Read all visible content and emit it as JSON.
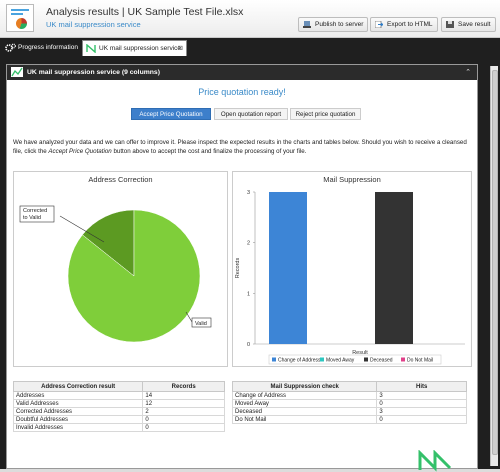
{
  "header": {
    "title": "Analysis results | UK Sample Test File.xlsx",
    "subtitle": "UK mail suppression service",
    "publish_label": "Publish to server",
    "export_label": "Export to HTML",
    "save_label": "Save result"
  },
  "tabs": [
    {
      "label": "Progress information"
    },
    {
      "label": "UK mail suppression service",
      "close": "⊠"
    }
  ],
  "panel": {
    "title": "UK mail suppression service (9 columns)",
    "collapse": "⌃",
    "quote_title": "Price quotation ready!",
    "buttons": {
      "accept": "Accept Price Quotation",
      "open": "Open quotation report",
      "reject": "Reject price quotation"
    },
    "description_1": "We have analyzed your data and we can offer to improve it. Please inspect the expected results in the charts and tables below. Should you wish to receive a cleansed",
    "description_2a": "file, click the ",
    "description_2b": "Accept Price Quotation",
    "description_2c": " button above to accept the cost and finalize the processing of your file."
  },
  "chart_data": [
    {
      "type": "pie",
      "title": "Address Correction",
      "slices": [
        {
          "name": "Valid",
          "value": 12,
          "color": "#7fce3a"
        },
        {
          "name": "Corrected to Valid",
          "value": 2,
          "color": "#5c9a22"
        }
      ],
      "callout_valid": "Valid",
      "callout_corrected": "Corrected\nto Valid"
    },
    {
      "type": "bar",
      "title": "Mail Suppression",
      "xlabel": "Result",
      "ylabel": "Records",
      "ylim": [
        0,
        3
      ],
      "yticks": [
        "0",
        "1",
        "2",
        "3"
      ],
      "categories": [
        "Change of Address",
        "Moved Away",
        "Deceased",
        "Do Not Mail"
      ],
      "values": [
        3,
        0,
        3,
        0
      ],
      "colors": [
        "#3d85d6",
        "#2ec7c0",
        "#333333",
        "#e0408a"
      ],
      "legend": [
        "Change of Address",
        "Moved Away",
        "Deceased",
        "Do Not Mail"
      ]
    }
  ],
  "address_table": {
    "headers": [
      "Address Correction result",
      "Records"
    ],
    "rows": [
      [
        "Addresses",
        "14"
      ],
      [
        "Valid Addresses",
        "12"
      ],
      [
        "Corrected Addresses",
        "2"
      ],
      [
        "Doubtful Addresses",
        "0"
      ],
      [
        "Invalid Addresses",
        "0"
      ]
    ]
  },
  "suppression_table": {
    "headers": [
      "Mail Suppression check",
      "Hits"
    ],
    "rows": [
      [
        "Change of Address",
        "3"
      ],
      [
        "Moved Away",
        "0"
      ],
      [
        "Deceased",
        "3"
      ],
      [
        "Do Not Mail",
        "0"
      ]
    ]
  },
  "colors": {
    "accent": "#3a8ac8",
    "primary_button": "#3d7fcb",
    "logo": "#34c06a"
  }
}
